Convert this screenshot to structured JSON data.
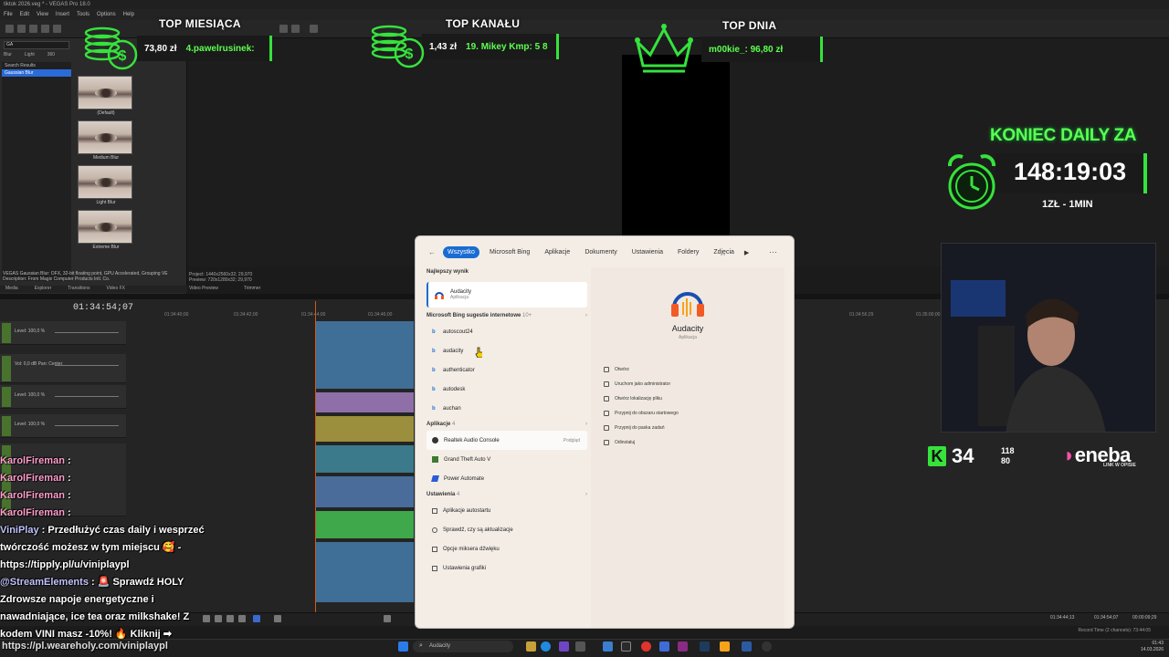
{
  "app": {
    "title": "tiktok 2026.veg * - VEGAS Pro 18.0",
    "menu": [
      "File",
      "Edit",
      "View",
      "Insert",
      "Tools",
      "Options",
      "Help"
    ]
  },
  "fx_panel": {
    "search_value": "GA",
    "tabs": [
      "Blur",
      "Light",
      "360"
    ],
    "list": [
      "Search Results",
      "Gaussian Blur"
    ],
    "presets": [
      "(Default)",
      "Medium Blur",
      "Light Blur",
      "Extreme Blur"
    ],
    "description": "VEGAS Gaussian Blur: OFX, 32-bit floating point, GPU Accelerated, Grouping VE Description: From Magix Computer Products Intl. Co.",
    "bottom_tabs": [
      "Media",
      "Explorer",
      "Transitions",
      "Video FX"
    ]
  },
  "preview": {
    "info_line1": "Project: 1440x2560x32; 29,970",
    "info_line2": "Preview: 720x1280x32; 29,970",
    "tabs": [
      "Video Preview",
      "Trimmer"
    ]
  },
  "timeline": {
    "timecode": "01:34:54;07",
    "ruler": [
      "01:34:40;00",
      "01:34:42;00",
      "01:34:44;00",
      "01:34:46;00",
      "01:34:56;29",
      "01:35:00;00"
    ],
    "tracks": [
      {
        "label": "Level: 100,0 %"
      },
      {
        "label": "Vol: 0,0 dB  Pan: Center"
      },
      {
        "label": "Level: 100,0 %"
      },
      {
        "label": "Level: 100,0 %"
      }
    ],
    "end_times": [
      "01:34:44;13",
      "01:34:54;07",
      "00:00:09;29"
    ],
    "record_info": "Record Time (2 channels): 73:44:05"
  },
  "overlay": {
    "top_miesiaca": {
      "label": "TOP MIESIĄCA",
      "amount": "73,80 zł",
      "name": "4.pawelrusinek:"
    },
    "top_kanalu": {
      "label": "TOP KANAŁU",
      "amount": "1,43 zł",
      "name": "19. Mikey Kmp: 5 8"
    },
    "top_dnia": {
      "label": "TOP DNIA",
      "name": "m00kie_: 96,80 zł"
    },
    "koniec_label": "KONIEC DAILY ZA",
    "timer": "148:19:03",
    "rate": "1ZŁ - 1MIN",
    "k_count": "34",
    "stat_top": "118",
    "stat_bottom": "80",
    "brand": "eneba",
    "brand_sub": "LINK W OPISIE",
    "url": "https://pl.weareholy.com/viniplaypl"
  },
  "chat": [
    {
      "user": "KarolFireman",
      "text": " :"
    },
    {
      "user": "KarolFireman",
      "text": " :"
    },
    {
      "user": "KarolFireman",
      "text": " :"
    },
    {
      "user": "KarolFireman",
      "text": " :"
    },
    {
      "user": "ViniPlay",
      "text": " : Przedłużyć czas daily i wesprzeć twórczość możesz w tym miejscu 🥰 - https://tipply.pl/u/viniplaypl"
    },
    {
      "user": "@StreamElements",
      "text": " : 🚨 Sprawdź HOLY Zdrowsze napoje energetyczne i nawadniające, ice tea oraz milkshake! Z kodem VINI masz -10%! 🔥 Kliknij ➡"
    }
  ],
  "search_flyout": {
    "tabs": [
      "Wszystko",
      "Microsoft Bing",
      "Aplikacje",
      "Dokumenty",
      "Ustawienia",
      "Foldery",
      "Zdjęcia"
    ],
    "best_header": "Najlepszy wynik",
    "best": {
      "name": "Audacity",
      "type": "Aplikacja"
    },
    "bing_header": "Microsoft Bing sugestie internetowe",
    "bing_count": "10+",
    "bing_items": [
      "autoscout24",
      "audacity",
      "authenticator",
      "autodesk",
      "auchan"
    ],
    "apps_header": "Aplikacje",
    "apps_count": "4",
    "apps": [
      "Realtek Audio Console",
      "Grand Theft Auto V",
      "Power Automate"
    ],
    "apps_tag": "Podgląd",
    "settings_header": "Ustawienia",
    "settings_count": "4",
    "settings": [
      "Aplikacje autostartu",
      "Sprawdź, czy są aktualizacje",
      "Opcje miksera dźwięku",
      "Ustawienia grafiki"
    ],
    "detail_name": "Audacity",
    "detail_type": "Aplikacja",
    "actions": [
      "Otwórz",
      "Uruchom jako administrator",
      "Otwórz lokalizację pliku",
      "Przypnij do obszaru startowego",
      "Przypnij do paska zadań",
      "Odinstaluj"
    ]
  },
  "taskbar": {
    "search_value": "Audacity",
    "time": "01:43",
    "date": "14.03.2026"
  },
  "colors": {
    "accent_green": "#36e23c",
    "win_accent": "#1a6cd3",
    "playhead": "#d05a1a"
  }
}
